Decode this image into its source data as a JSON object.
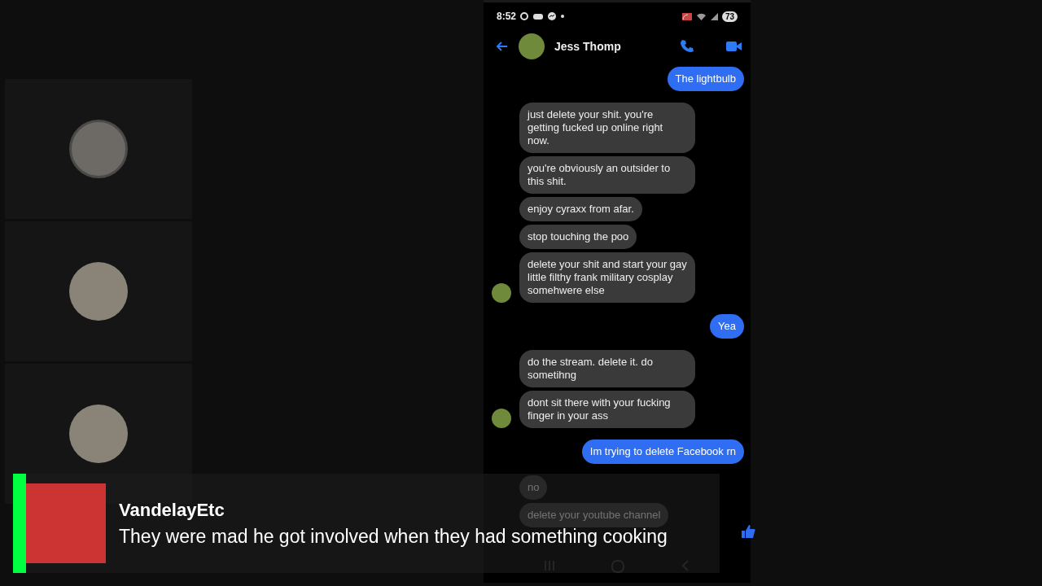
{
  "participant_tiles": [
    {
      "ring": true
    },
    {
      "ring": false
    },
    {
      "ring": false
    }
  ],
  "phone": {
    "status_bar": {
      "time": "8:52",
      "battery": "73"
    },
    "header": {
      "contact": "Jess Thomp"
    },
    "messages": [
      {
        "kind": "sent",
        "text": "The lightbulb"
      },
      {
        "kind": "received",
        "text": "just delete your shit.  you're getting fucked up online right now.",
        "avatar": false
      },
      {
        "kind": "received",
        "text": "you're obviously an outsider to this shit.",
        "avatar": false
      },
      {
        "kind": "received",
        "text": "enjoy cyraxx from afar.",
        "avatar": false
      },
      {
        "kind": "received",
        "text": "stop touching the poo",
        "avatar": false
      },
      {
        "kind": "received",
        "text": "delete your shit and start your gay little filthy frank military cosplay somehwere else",
        "avatar": true
      },
      {
        "kind": "sent",
        "text": "Yea"
      },
      {
        "kind": "received",
        "text": "do the stream.  delete it.  do sometihng",
        "avatar": false
      },
      {
        "kind": "received",
        "text": "dont sit there with your fucking finger in your ass",
        "avatar": true
      },
      {
        "kind": "sent",
        "text": "Im trying to delete Facebook rn"
      },
      {
        "kind": "received",
        "text": "no",
        "avatar": false
      },
      {
        "kind": "received",
        "text": "delete your youtube channel",
        "avatar": false
      }
    ]
  },
  "comment": {
    "author": "VandelayEtc",
    "text": "They were mad he got involved when they had something cooking"
  }
}
